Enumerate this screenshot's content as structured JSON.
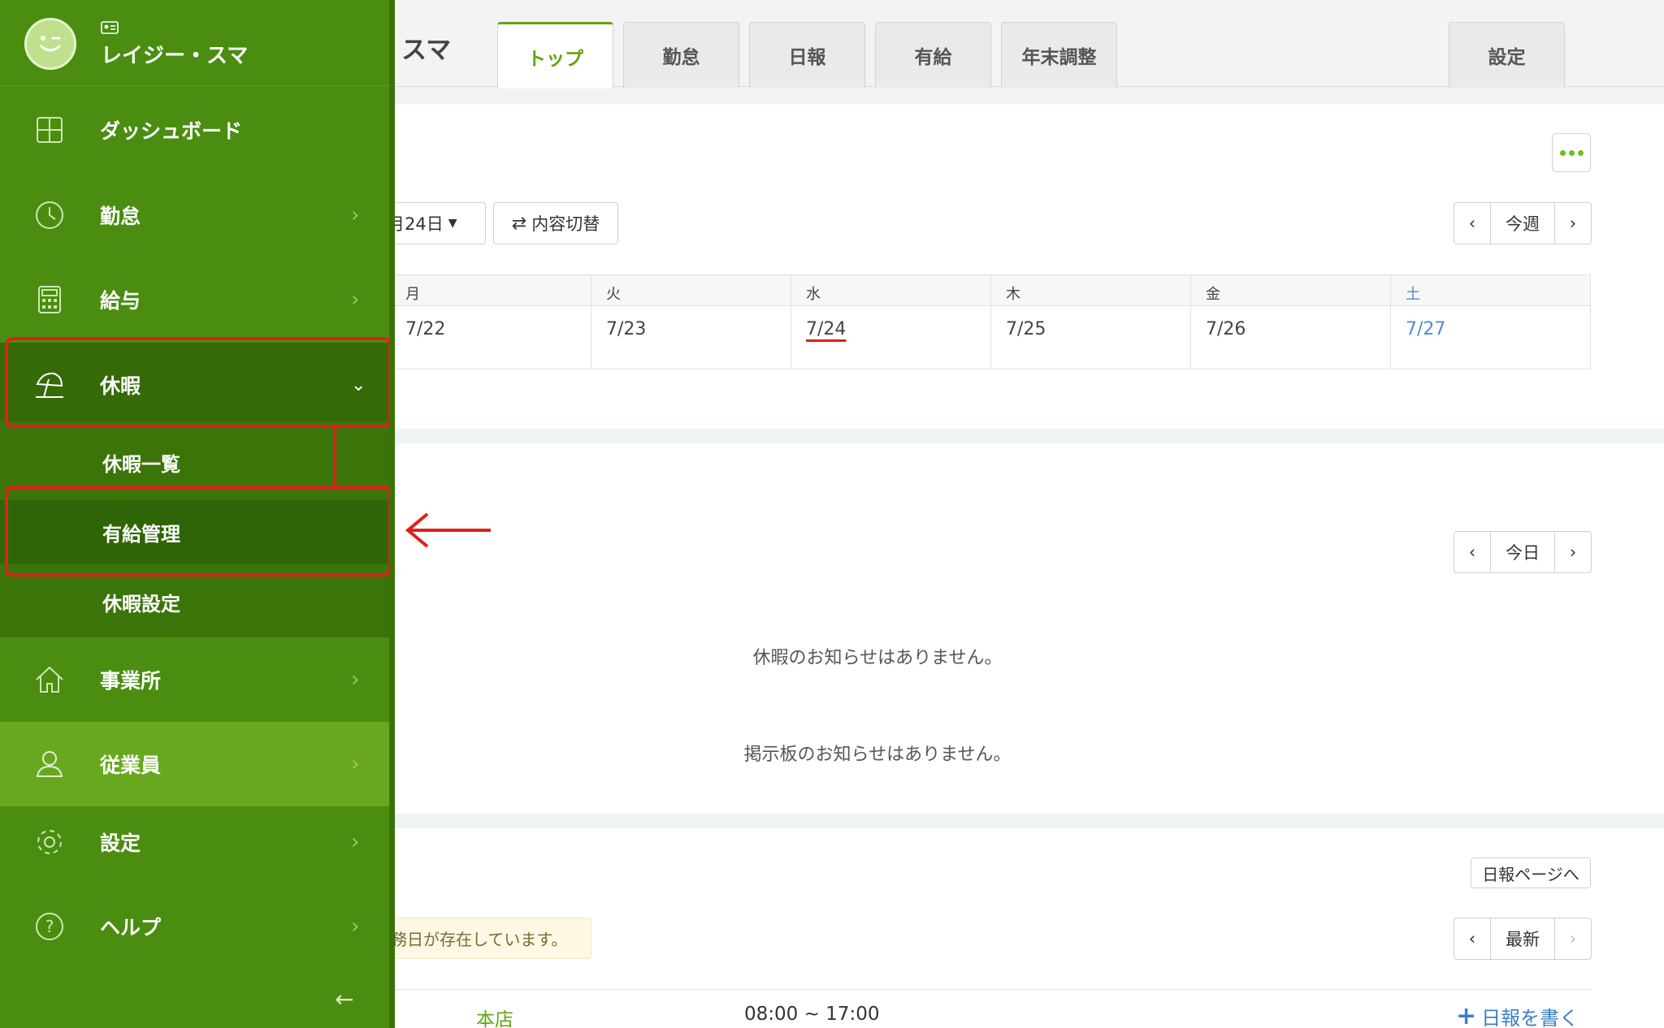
{
  "app": {
    "title_partial": "スマ"
  },
  "tabs": [
    {
      "label": "トップ",
      "active": true
    },
    {
      "label": "勤怠"
    },
    {
      "label": "日報"
    },
    {
      "label": "有給"
    },
    {
      "label": "年末調整"
    }
  ],
  "settings_tab": "設定",
  "week": {
    "date_dropdown": "月24日",
    "toggle_button": "内容切替",
    "pager_label": "今週",
    "days": [
      {
        "label": "月",
        "date": "7/22"
      },
      {
        "label": "火",
        "date": "7/23"
      },
      {
        "label": "水",
        "date": "7/24",
        "today": true
      },
      {
        "label": "木",
        "date": "7/25"
      },
      {
        "label": "金",
        "date": "7/26"
      },
      {
        "label": "土",
        "date": "7/27",
        "saturday": true
      }
    ]
  },
  "notices": {
    "pager_label": "今日",
    "leave_empty": "休暇のお知らせはありません。",
    "board_empty": "掲示板のお知らせはありません。"
  },
  "daily": {
    "page_link": "日報ページへ",
    "pager_label": "最新",
    "warning": "務日が存在しています。",
    "store": "本店",
    "time": "08:00 ~ 17:00",
    "write_link": "日報を書く"
  },
  "sidebar": {
    "user_name": "レイジー・スマ",
    "items": [
      {
        "label": "ダッシュボード",
        "icon": "dashboard-icon"
      },
      {
        "label": "勤怠",
        "icon": "clock-icon"
      },
      {
        "label": "給与",
        "icon": "calculator-icon"
      },
      {
        "label": "休暇",
        "icon": "beach-umbrella-icon"
      },
      {
        "label": "事業所",
        "icon": "home-icon"
      },
      {
        "label": "従業員",
        "icon": "user-icon"
      },
      {
        "label": "設定",
        "icon": "gear-icon"
      },
      {
        "label": "ヘルプ",
        "icon": "help-icon"
      }
    ],
    "leave_sub": [
      {
        "label": "休暇一覧"
      },
      {
        "label": "有給管理"
      },
      {
        "label": "休暇設定"
      }
    ]
  },
  "colors": {
    "brand_green": "#4a8d10",
    "accent_green": "#5fa511",
    "highlight_red": "#e0201b",
    "link_blue": "#3c7fc9"
  }
}
